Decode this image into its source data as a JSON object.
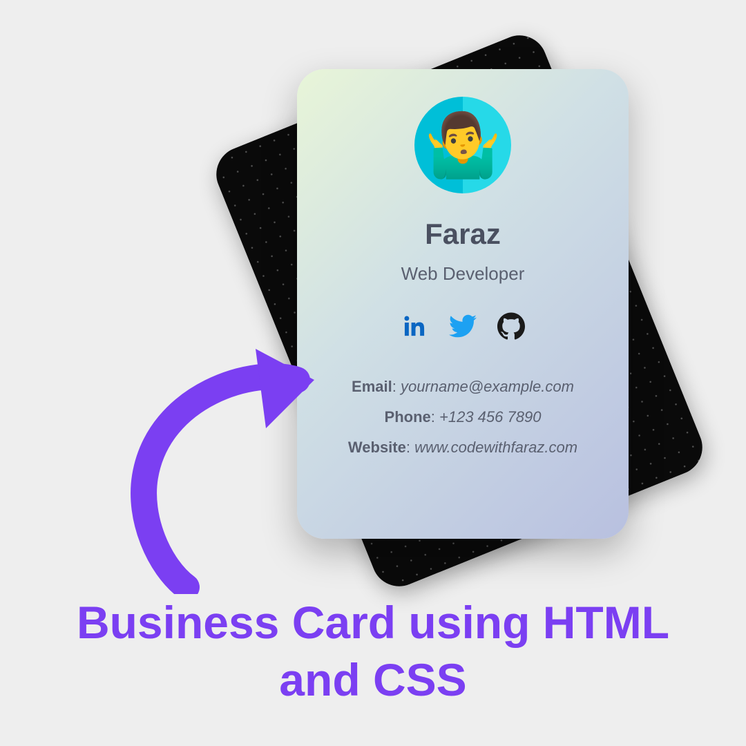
{
  "card": {
    "name": "Faraz",
    "role": "Web Developer",
    "avatar_emoji": "🤷‍♂️",
    "contact": {
      "email_label": "Email",
      "email_value": "yourname@example.com",
      "phone_label": "Phone",
      "phone_value": "+123 456 7890",
      "website_label": "Website",
      "website_value": "www.codewithfaraz.com"
    },
    "social": {
      "linkedin": "linkedin-icon",
      "twitter": "twitter-icon",
      "github": "github-icon"
    }
  },
  "headline": "Business Card using HTML and CSS",
  "colors": {
    "accent": "#7b3ff2",
    "linkedin": "#0a66c2",
    "twitter": "#1da1f2",
    "github": "#1a1a1a"
  }
}
